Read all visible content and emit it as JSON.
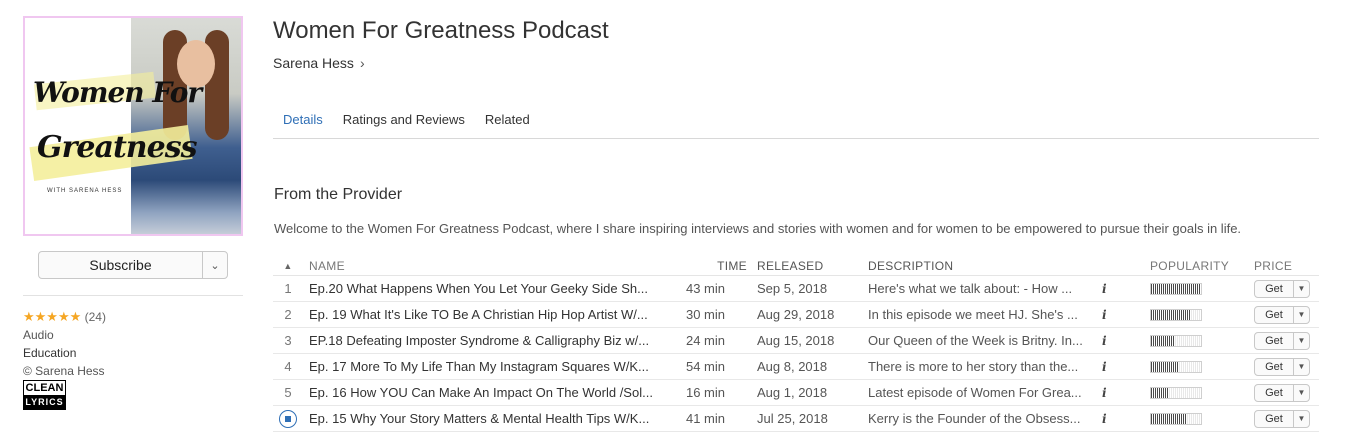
{
  "artwork": {
    "title_line1": "Women For",
    "title_line2": "Greatness",
    "subtitle": "WITH SARENA HESS"
  },
  "subscribe": {
    "label": "Subscribe"
  },
  "meta": {
    "stars": "★★★★★",
    "rating_count": "(24)",
    "kind": "Audio",
    "category": "Education",
    "copyright": "© Sarena Hess",
    "badge_top": "CLEAN",
    "badge_bottom": "LYRICS"
  },
  "podcast": {
    "title": "Women For Greatness Podcast",
    "author": "Sarena Hess"
  },
  "tabs": [
    {
      "label": "Details"
    },
    {
      "label": "Ratings and Reviews"
    },
    {
      "label": "Related"
    }
  ],
  "provider": {
    "heading": "From the Provider",
    "description": "Welcome to the Women For Greatness Podcast, where I share inspiring interviews and stories with women and for women to be empowered to pursue their goals in life."
  },
  "table": {
    "headers": {
      "name": "NAME",
      "time": "TIME",
      "released": "RELEASED",
      "description": "DESCRIPTION",
      "popularity": "POPULARITY",
      "price": "PRICE"
    },
    "rows": [
      {
        "num": "1",
        "name": "Ep.20 What Happens When You Let Your Geeky Side Sh...",
        "time": "43 min",
        "released": "Sep 5, 2018",
        "description": "Here's what we talk about: - How ...",
        "info": "i",
        "popularity": 1.0,
        "price": "Get"
      },
      {
        "num": "2",
        "name": "Ep. 19 What It's Like TO Be A Christian Hip Hop Artist W/...",
        "time": "30 min",
        "released": "Aug 29, 2018",
        "description": "In this episode we meet HJ. She's ...",
        "info": "i",
        "popularity": 0.8,
        "price": "Get"
      },
      {
        "num": "3",
        "name": "EP.18 Defeating Imposter Syndrome & Calligraphy Biz w/...",
        "time": "24 min",
        "released": "Aug 15, 2018",
        "description": "Our Queen of the Week is Britny. In...",
        "info": "i",
        "popularity": 0.45,
        "price": "Get"
      },
      {
        "num": "4",
        "name": "Ep. 17 More To My Life Than My Instagram Squares W/K...",
        "time": "54 min",
        "released": "Aug 8, 2018",
        "description": "There is more to her story than the...",
        "info": "i",
        "popularity": 0.55,
        "price": "Get"
      },
      {
        "num": "5",
        "name": "Ep. 16 How YOU Can Make An Impact On The World /Sol...",
        "time": "16 min",
        "released": "Aug 1, 2018",
        "description": "Latest episode of Women For Grea...",
        "info": "i",
        "popularity": 0.35,
        "price": "Get"
      },
      {
        "num": "",
        "name": "Ep. 15 Why Your Story Matters & Mental Health Tips W/K...",
        "time": "41 min",
        "released": "Jul 25, 2018",
        "description": "Kerry is the Founder of the Obsess...",
        "info": "i",
        "popularity": 0.7,
        "price": "Get",
        "playing": true
      }
    ]
  }
}
